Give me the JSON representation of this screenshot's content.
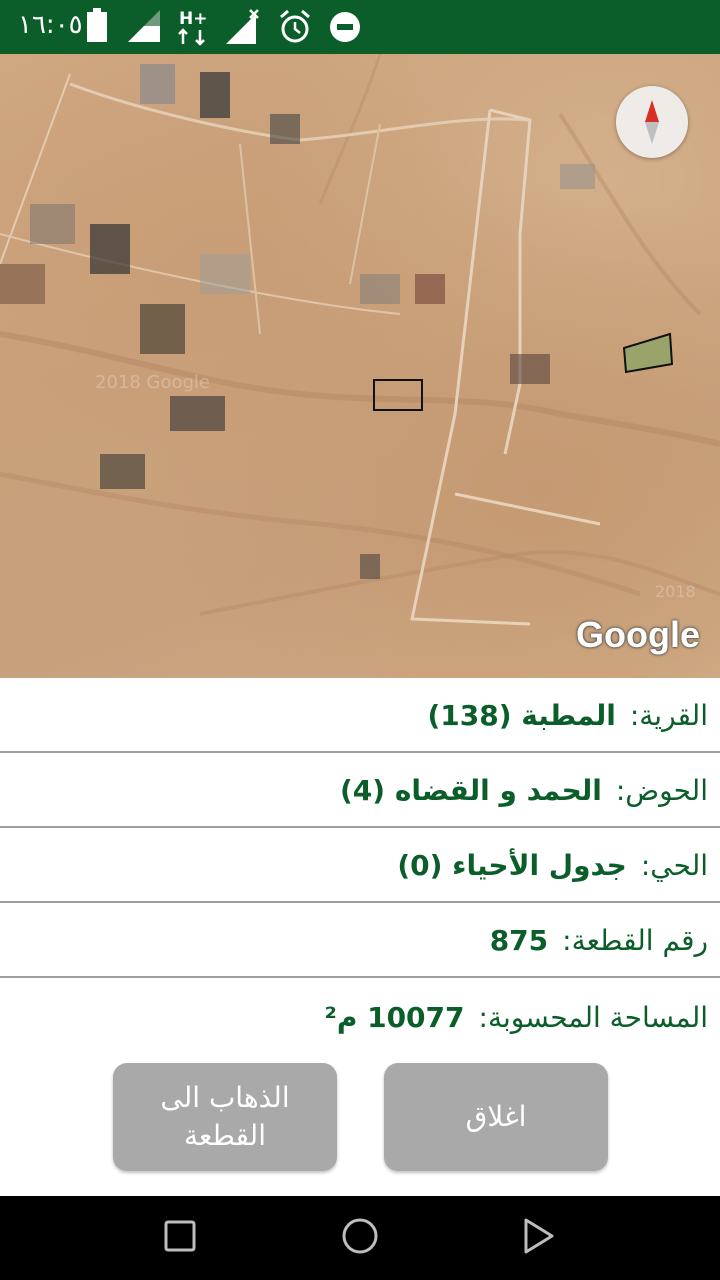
{
  "status_bar": {
    "time": "١٦:٠٥",
    "icons": [
      "battery-icon",
      "signal-icon",
      "hplus-data-icon",
      "no-signal-icon",
      "alarm-icon",
      "do-not-disturb-icon"
    ]
  },
  "map": {
    "watermark": "Google",
    "compass_icon": "compass-icon",
    "watermark_year": "2018"
  },
  "parcel_info": {
    "village_label": "القرية:",
    "village_value": "المطبة (138)",
    "basin_label": "الحوض:",
    "basin_value": "الحمد و القضاه (4)",
    "district_label": "الحي:",
    "district_value": "جدول الأحياء (0)",
    "parcel_number_label": "رقم القطعة:",
    "parcel_number_value": "875",
    "area_label": "المساحة المحسوبة:",
    "area_value": "10077",
    "area_unit": "م²"
  },
  "buttons": {
    "goto_label_line1": "الذهاب الى",
    "goto_label_line2": "القطعة",
    "close_label": "اغلاق"
  },
  "colors": {
    "status_bar": "#0b5e2a",
    "text_green": "#0b5e2a",
    "button_gray": "#a9a9a9",
    "divider": "#9e9e9e",
    "nav_bar": "#000000"
  },
  "nav_bar": {
    "icons": [
      "recents-icon",
      "home-icon",
      "back-icon"
    ]
  }
}
